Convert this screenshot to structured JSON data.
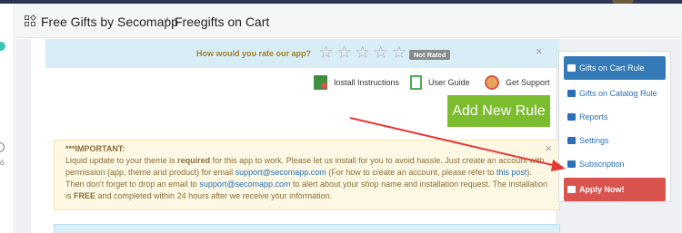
{
  "breadcrumb": {
    "app_name": "Free Gifts by Secomapp",
    "separator": "/",
    "current": "Freegifts on Cart"
  },
  "rating": {
    "question": "How would you rate our app?",
    "stars": [
      "☆",
      "☆",
      "☆",
      "☆",
      "☆"
    ],
    "badge": "Not Rated",
    "close": "×"
  },
  "help_links": {
    "install": "Install Instructions",
    "guide": "User Guide",
    "support": "Get Support"
  },
  "add_rule_label": "Add New Rule",
  "important": {
    "title": "***IMPORTANT:",
    "text_1": "Liquid update to your theme is ",
    "text_required": "required",
    "text_2": " for this app to work. Please let us install for you to avoid hassle. Just create an account with permission (app, theme and product) for email ",
    "email_1": "support@secomapp.com",
    "text_3": " (For how to create an account, please refer to ",
    "post_link": "this post",
    "text_4": "). Then don't forget to drop an email to ",
    "email_2": "support@secomapp.com",
    "text_5": " to alert about your shop name and installation request. The installation is ",
    "text_free": "FREE",
    "text_6": " and completed within 24 hours after we receive your information.",
    "close": "×"
  },
  "sidebar": {
    "items": [
      {
        "label": "Gifts on Cart Rule",
        "icon": "cart-icon"
      },
      {
        "label": "Gifts on Catalog Rule",
        "icon": "tag-icon"
      },
      {
        "label": "Reports",
        "icon": "bar-chart-icon"
      },
      {
        "label": "Settings",
        "icon": "gears-icon"
      },
      {
        "label": "Subscription",
        "icon": "envelope-icon"
      },
      {
        "label": "Apply Now!",
        "icon": "save-icon"
      }
    ]
  },
  "colors": {
    "accent_green": "#7cbc2f",
    "active_blue": "#337ab7",
    "apply_red": "#d9534f",
    "info_bg": "#d9edf7",
    "warning_bg": "#fcf8e3",
    "arrow_red": "#e53935"
  }
}
